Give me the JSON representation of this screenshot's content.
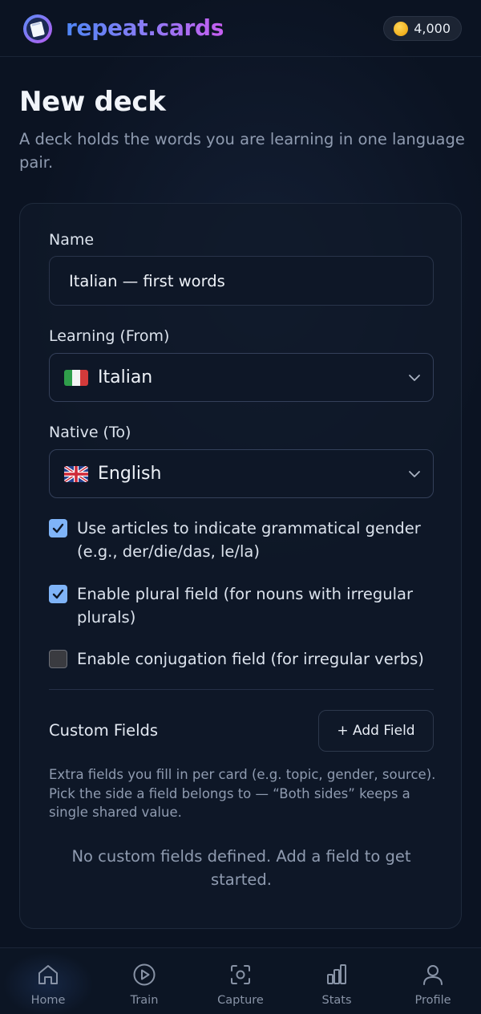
{
  "header": {
    "brand": "repeat.cards",
    "coins": "4,000"
  },
  "page": {
    "title": "New deck",
    "subtitle": "A deck holds the words you are learning in one language pair."
  },
  "form": {
    "name_label": "Name",
    "name_value": "Italian — first words",
    "learning_label": "Learning (From)",
    "learning_value": "Italian",
    "native_label": "Native (To)",
    "native_value": "English",
    "options": [
      {
        "label": "Use articles to indicate grammatical gender (e.g., der/die/das, le/la)",
        "checked": true
      },
      {
        "label": "Enable plural field (for nouns with irregular plurals)",
        "checked": true
      },
      {
        "label": "Enable conjugation field (for irregular verbs)",
        "checked": false
      }
    ]
  },
  "custom_fields": {
    "title": "Custom Fields",
    "add_button": "+ Add Field",
    "help": "Extra fields you fill in per card (e.g. topic, gender, source). Pick the side a field belongs to — “Both sides” keeps a single shared value.",
    "empty": "No custom fields defined. Add a field to get started."
  },
  "nav": {
    "items": [
      {
        "label": "Home",
        "icon": "home-icon",
        "active": true
      },
      {
        "label": "Train",
        "icon": "play-icon",
        "active": false
      },
      {
        "label": "Capture",
        "icon": "capture-icon",
        "active": false
      },
      {
        "label": "Stats",
        "icon": "stats-icon",
        "active": false
      },
      {
        "label": "Profile",
        "icon": "profile-icon",
        "active": false
      }
    ]
  },
  "colors": {
    "accent": "#7fb4f8",
    "brand_start": "#4f86f7",
    "brand_end": "#c65ef0",
    "background": "#0b1322"
  }
}
